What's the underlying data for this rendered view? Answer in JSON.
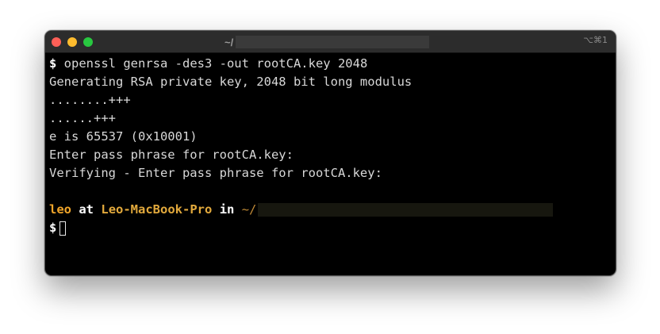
{
  "window": {
    "title": "~/",
    "shortcut": "⌥⌘1",
    "colors": {
      "close": "#fe5f57",
      "minimize": "#febc2e",
      "zoom": "#28c840",
      "background": "#000000",
      "prompt_user": "#f0a52a"
    }
  },
  "terminal": {
    "prompt_symbol": "$",
    "command": " openssl genrsa -des3 -out rootCA.key 2048",
    "output": [
      "Generating RSA private key, 2048 bit long modulus",
      "........+++",
      "......+++",
      "e is 65537 (0x10001)",
      "Enter pass phrase for rootCA.key:",
      "Verifying - Enter pass phrase for rootCA.key:"
    ],
    "prompt": {
      "user": "leo",
      "at": "at",
      "host": "Leo-MacBook-Pro",
      "in": "in",
      "path": "~/"
    },
    "current_prompt_symbol": "$"
  }
}
